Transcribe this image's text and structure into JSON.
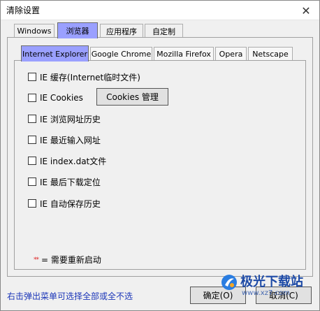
{
  "window": {
    "title": "清除设置",
    "close_label": "✕"
  },
  "tabs": [
    {
      "label": "Windows"
    },
    {
      "label": "浏览器"
    },
    {
      "label": "应用程序"
    },
    {
      "label": "自定制"
    }
  ],
  "active_tab": "浏览器",
  "inner_tabs": [
    {
      "label": "Internet Explorer"
    },
    {
      "label": "Google Chrome"
    },
    {
      "label": "Mozilla Firefox"
    },
    {
      "label": "Opera"
    },
    {
      "label": "Netscape"
    }
  ],
  "active_inner_tab": "Internet Explorer",
  "options": [
    {
      "label": "IE 缓存(Internet临时文件)",
      "checked": false
    },
    {
      "label": "IE Cookies",
      "checked": false
    },
    {
      "label": "IE 浏览网址历史",
      "checked": false
    },
    {
      "label": "IE 最近输入网址",
      "checked": false
    },
    {
      "label": "IE index.dat文件",
      "checked": false
    },
    {
      "label": "IE 最后下载定位",
      "checked": false
    },
    {
      "label": "IE 自动保存历史",
      "checked": false
    }
  ],
  "cookies_button": {
    "label": "Cookies 管理"
  },
  "note": {
    "marker": "**",
    "text": "= 需要重新启动"
  },
  "hint": "右击弹出菜单可选择全部或全不选",
  "buttons": {
    "ok": "确定(O)",
    "cancel": "取消(C)"
  },
  "watermark": {
    "text": "极光下载站",
    "url": "www.xz7.com"
  },
  "colors": {
    "active_tab": "#9aa0ff",
    "hint": "#1a35b8",
    "marker": "#dd2222"
  }
}
